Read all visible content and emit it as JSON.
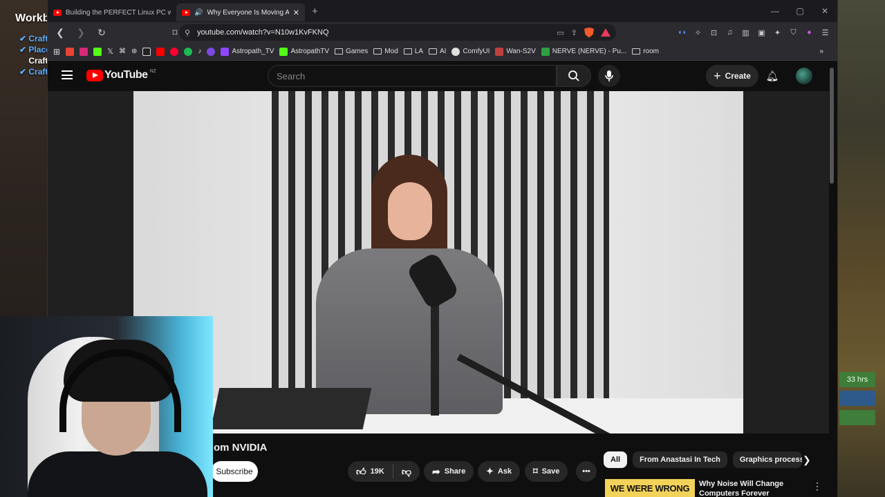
{
  "game": {
    "title": "Workb",
    "items": [
      {
        "label": "Craft",
        "style": "blue"
      },
      {
        "label": "Place",
        "style": "blue"
      },
      {
        "label": "Craft",
        "style": "white"
      },
      {
        "label": "Craft",
        "style": "blue"
      }
    ],
    "timer": "33 hrs"
  },
  "browser": {
    "tabs": [
      {
        "title": "Building the PERFECT Linux PC with L",
        "active": false
      },
      {
        "title": "Why Everyone Is Moving Away",
        "active": true
      }
    ],
    "url": "youtube.com/watch?v=N10w1KvFKNQ",
    "bookmarks": [
      {
        "label": "Astropath_TV",
        "icon": "twitch-icon",
        "color": "#9146ff"
      },
      {
        "label": "AstropathTV",
        "icon": "kick-icon",
        "color": "#53fc18"
      },
      {
        "label": "Games",
        "icon": "folder-icon"
      },
      {
        "label": "Mod",
        "icon": "folder-icon"
      },
      {
        "label": "LA",
        "icon": "folder-icon"
      },
      {
        "label": "AI",
        "icon": "folder-icon"
      },
      {
        "label": "ComfyUI",
        "icon": "comfy-icon",
        "color": "#e0e0e0"
      },
      {
        "label": "Wan-S2V",
        "icon": "wan-icon",
        "color": "#c04040"
      },
      {
        "label": "NERVE (NERVE) - Pu...",
        "icon": "nerve-icon",
        "color": "#2ea043"
      },
      {
        "label": "room",
        "icon": "folder-icon"
      }
    ]
  },
  "youtube": {
    "logo_text": "YouTube",
    "country": "NZ",
    "search_placeholder": "Search",
    "create_label": "Create",
    "video_title_visible": "om NVIDIA",
    "subscribe_label": "Subscribe",
    "likes": "19K",
    "share_label": "Share",
    "ask_label": "Ask",
    "save_label": "Save",
    "chips": [
      "All",
      "From Anastasi In Tech",
      "Graphics processi"
    ],
    "recommendation": {
      "thumb_text": "WE WERE WRONG",
      "title": "Why Noise Will Change Computers Forever"
    }
  },
  "colors": {
    "brand_red": "#ff0000",
    "page_bg": "#0f0f0f",
    "chip_selected": "#f1f1f1"
  }
}
